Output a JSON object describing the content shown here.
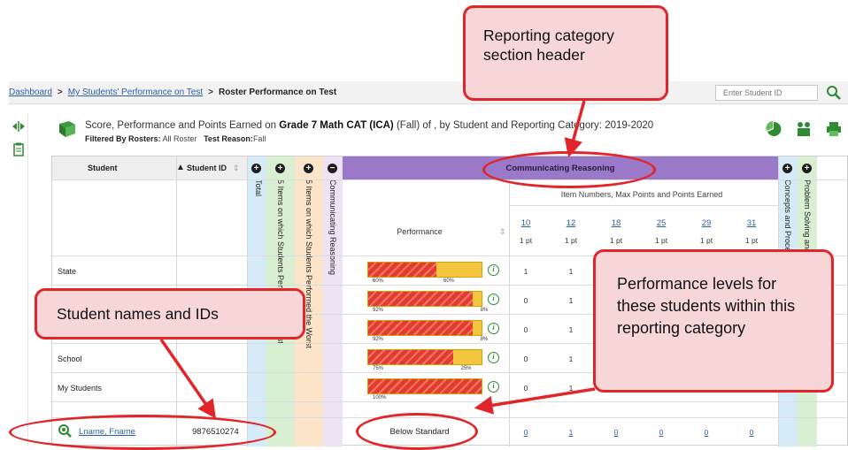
{
  "breadcrumb": {
    "items": [
      "Dashboard",
      "My Students' Performance on Test"
    ],
    "current": "Roster Performance on Test"
  },
  "search": {
    "placeholder": "Enter Student ID"
  },
  "report": {
    "title_prefix": "Score, Performance and Points Earned on ",
    "test_name": "Grade 7 Math CAT (ICA)",
    "title_suffix": " (Fall) of , by Student and Reporting Category: 2019-2020",
    "filter_label": "Filtered By Rosters:",
    "filter_value": "All Roster",
    "reason_label": "Test Reason:",
    "reason_value": "Fall"
  },
  "columns": {
    "student": "Student",
    "student_id": "Student ID",
    "total": "Total",
    "best": "5 Items on which Students Performed the Best",
    "worst": "5 Items on which Students Performed the Worst",
    "communicating": "Communicating Reasoning",
    "section_header": "Communicating Reasoning",
    "item_header": "Item Numbers, Max Points and Points Earned",
    "performance": "Performance",
    "concepts": "Concepts and Procedures",
    "problem": "Problem Solving and Modeling"
  },
  "items": [
    {
      "num": "10",
      "pts": "1 pt"
    },
    {
      "num": "12",
      "pts": "1 pt"
    },
    {
      "num": "18",
      "pts": "1 pt"
    },
    {
      "num": "25",
      "pts": "1 pt"
    },
    {
      "num": "29",
      "pts": "1 pt"
    },
    {
      "num": "31",
      "pts": "1 pt"
    }
  ],
  "rows": [
    {
      "name": "State",
      "perf_red": 0.6,
      "perf_yellow": 0.4,
      "red_label": "60%",
      "yellow_label": "60%",
      "scores": [
        "1",
        "1"
      ]
    },
    {
      "name": "",
      "perf_red": 0.92,
      "perf_yellow": 0.08,
      "red_label": "92%",
      "yellow_label": "8%",
      "scores": [
        "0",
        "1"
      ]
    },
    {
      "name": "",
      "perf_red": 0.92,
      "perf_yellow": 0.08,
      "red_label": "92%",
      "yellow_label": "8%",
      "scores": [
        "0",
        "1"
      ]
    },
    {
      "name": "School",
      "perf_red": 0.75,
      "perf_yellow": 0.25,
      "red_label": "75%",
      "yellow_label": "25%",
      "scores": [
        "0",
        "1"
      ]
    },
    {
      "name": "My Students",
      "perf_red": 1.0,
      "perf_yellow": 0.0,
      "red_label": "100%",
      "yellow_label": "",
      "scores": [
        "0",
        "1"
      ]
    }
  ],
  "student_row": {
    "name": "Lname, Fname",
    "id": "9876510274",
    "performance": "Below Standard",
    "scores": [
      "0",
      "1",
      "0",
      "0",
      "0",
      "0"
    ]
  },
  "callouts": {
    "header": "Reporting category section header",
    "students": "Student names and IDs",
    "levels": "Performance levels for these students within this reporting category"
  },
  "colors": {
    "accent_red": "#e0262a",
    "callout_fill": "#f6d6d6",
    "section_purple": "#9b79c9",
    "band_blue": "#d5ecf8",
    "band_green": "#d8efd2",
    "band_orange": "#fbe4c8",
    "band_purple": "#ece3f5",
    "bar_red": "#e53b2c",
    "bar_yellow": "#f4c63d",
    "link": "#2b5fa8"
  }
}
